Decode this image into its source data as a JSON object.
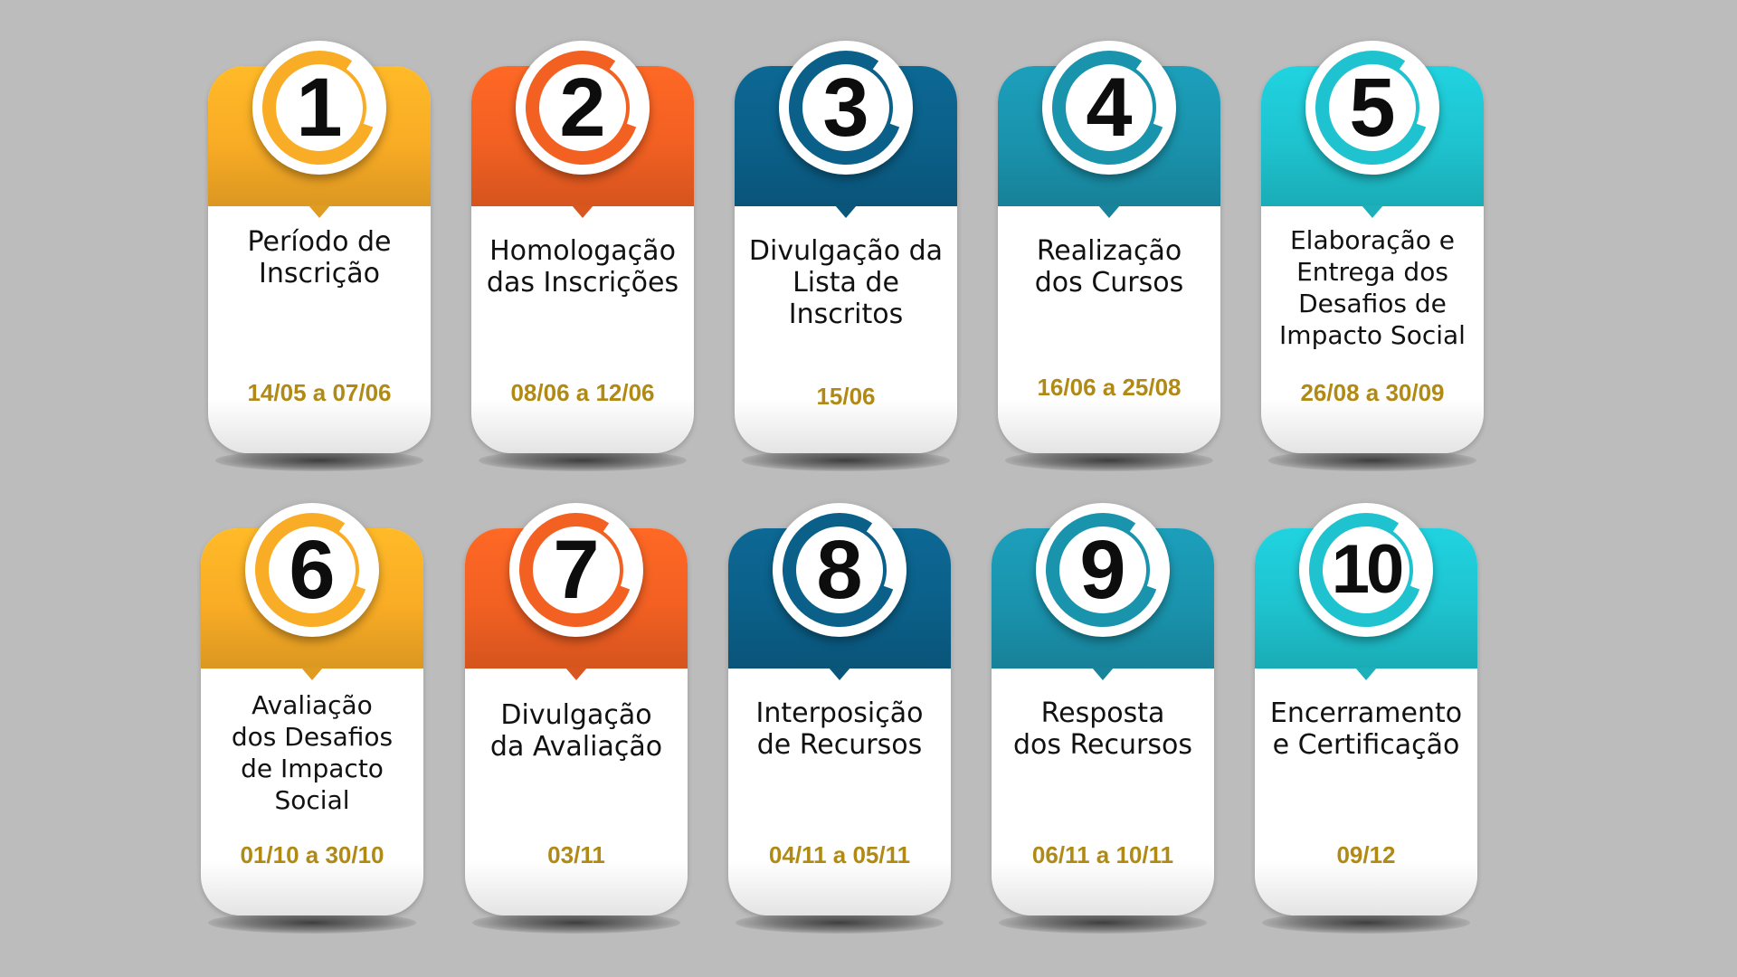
{
  "colors": {
    "background": "#bcbcbc",
    "date_text": "#b08a14",
    "yellow": "#f9ac25",
    "orange": "#f26022",
    "navy": "#0b6089",
    "teal": "#1a93ad",
    "cyan": "#1ec3cf"
  },
  "steps": [
    {
      "number": "1",
      "title": "Período de\nInscrição",
      "date": "14/05 a 07/06",
      "color": "yellow"
    },
    {
      "number": "2",
      "title": "Homologação\ndas Inscrições",
      "date": "08/06 a 12/06",
      "color": "orange"
    },
    {
      "number": "3",
      "title": "Divulgação da\nLista de\nInscritos",
      "date": "15/06",
      "color": "navy"
    },
    {
      "number": "4",
      "title": "Realização\ndos Cursos",
      "date": "16/06 a 25/08",
      "color": "teal"
    },
    {
      "number": "5",
      "title": "Elaboração e\nEntrega dos\nDesafios de\nImpacto Social",
      "date": "26/08 a 30/09",
      "color": "cyan"
    },
    {
      "number": "6",
      "title": "Avaliação\ndos Desafios\nde Impacto\nSocial",
      "date": "01/10 a 30/10",
      "color": "yellow"
    },
    {
      "number": "7",
      "title": "Divulgação\nda Avaliação",
      "date": "03/11",
      "color": "orange"
    },
    {
      "number": "8",
      "title": "Interposição\nde Recursos",
      "date": "04/11 a 05/11",
      "color": "navy"
    },
    {
      "number": "9",
      "title": "Resposta\ndos Recursos",
      "date": "06/11  a 10/11",
      "color": "teal"
    },
    {
      "number": "10",
      "title": "Encerramento\ne Certificação",
      "date": "09/12",
      "color": "cyan"
    }
  ]
}
